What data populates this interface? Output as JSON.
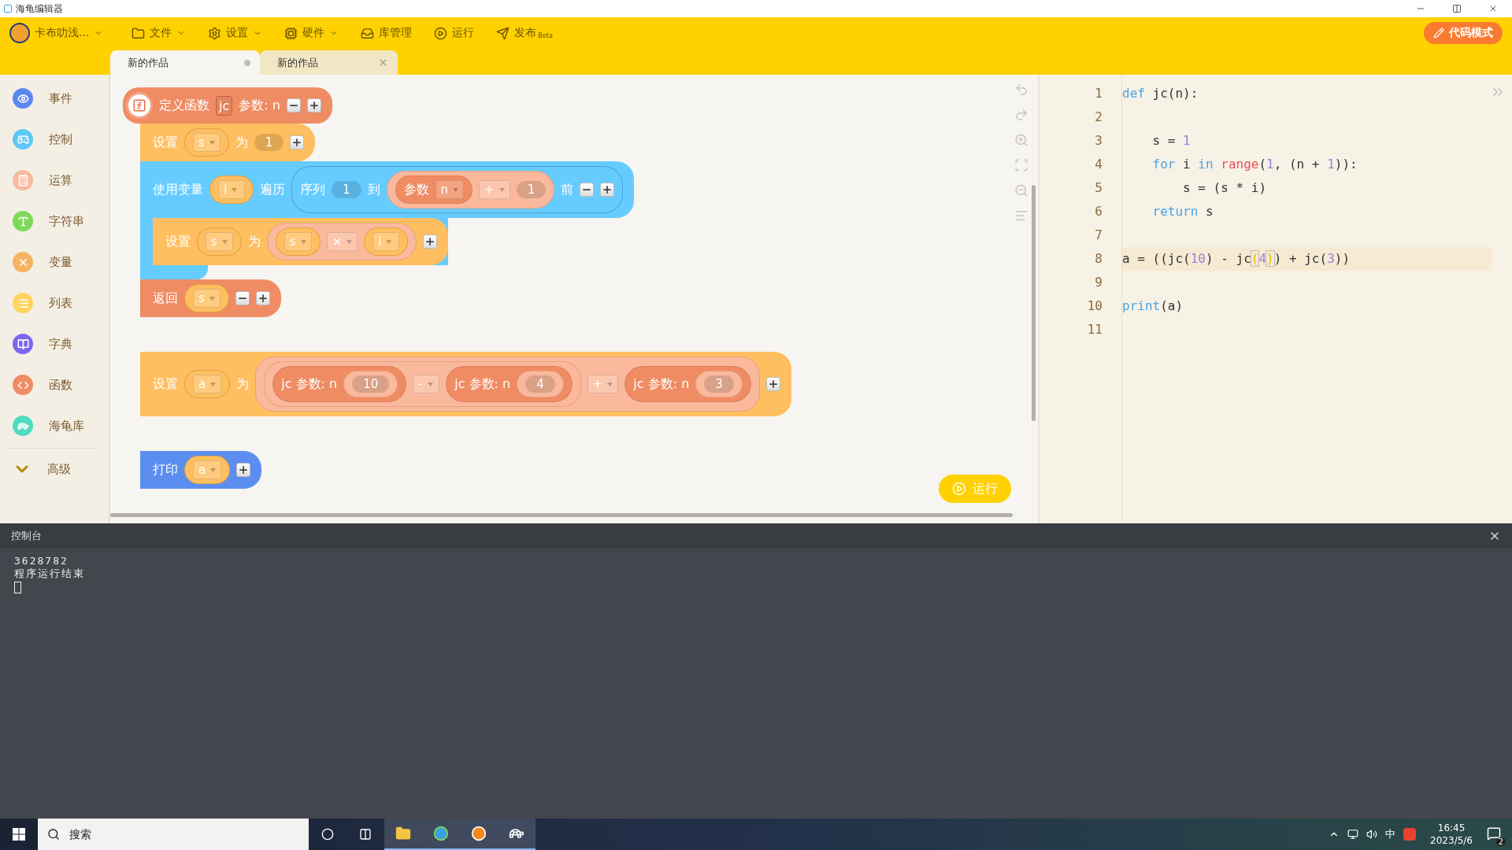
{
  "window": {
    "title": "海龟编辑器"
  },
  "toolbar": {
    "user": "卡布叻浅...",
    "menus": [
      {
        "label": "文件",
        "kind": "dropdown"
      },
      {
        "label": "设置",
        "kind": "dropdown"
      },
      {
        "label": "硬件",
        "kind": "dropdown"
      },
      {
        "label": "库管理",
        "kind": "action"
      },
      {
        "label": "运行",
        "kind": "action"
      },
      {
        "label": "发布",
        "kind": "action",
        "badge": "Beta"
      }
    ],
    "mode_button": "代码模式"
  },
  "tabs": [
    {
      "label": "新的作品",
      "selected": true,
      "kind": "unsaved"
    },
    {
      "label": "新的作品",
      "selected": false,
      "kind": "closable"
    }
  ],
  "sidebar": {
    "items": [
      {
        "label": "事件",
        "color": "#5b86f0"
      },
      {
        "label": "控制",
        "color": "#5ec8f8"
      },
      {
        "label": "运算",
        "color": "#f8b9a0"
      },
      {
        "label": "字符串",
        "color": "#7ed957"
      },
      {
        "label": "变量",
        "color": "#f5b363"
      },
      {
        "label": "列表",
        "color": "#ffd35c"
      },
      {
        "label": "字典",
        "color": "#7b68ee"
      },
      {
        "label": "函数",
        "color": "#ef8c63"
      },
      {
        "label": "海龟库",
        "color": "#4fdcc0"
      }
    ],
    "more": "高级"
  },
  "scripts": [
    {
      "blocks": [
        {
          "kind": "define",
          "parts": [
            {
              "kind": "label",
              "text": "定义函数"
            },
            {
              "kind": "name",
              "text": "jc"
            },
            {
              "kind": "label",
              "text": "参数: n"
            },
            {
              "kind": "remove"
            },
            {
              "kind": "add"
            }
          ],
          "children": [
            {
              "kind": "set",
              "parts": [
                {
                  "kind": "label",
                  "text": "设置"
                },
                {
                  "kind": "var",
                  "text": "s"
                },
                {
                  "kind": "label",
                  "text": "为"
                },
                {
                  "kind": "num",
                  "text": "1"
                },
                {
                  "kind": "add"
                }
              ]
            },
            {
              "kind": "loop",
              "parts": [
                {
                  "kind": "label",
                  "text": "使用变量"
                },
                {
                  "kind": "var",
                  "text": "i"
                },
                {
                  "kind": "label",
                  "text": "遍历"
                },
                {
                  "kind": "range",
                  "parts": [
                    {
                      "kind": "label",
                      "text": "序列"
                    },
                    {
                      "kind": "num",
                      "text": "1"
                    },
                    {
                      "kind": "label",
                      "text": "到"
                    },
                    {
                      "kind": "math",
                      "parts": [
                        {
                          "kind": "call",
                          "parts": [
                            {
                              "kind": "label",
                              "text": "参数"
                            },
                            {
                              "kind": "op",
                              "text": "n"
                            }
                          ]
                        },
                        {
                          "kind": "op",
                          "text": "+"
                        },
                        {
                          "kind": "num",
                          "text": "1"
                        }
                      ]
                    },
                    {
                      "kind": "label",
                      "text": "前"
                    },
                    {
                      "kind": "remove"
                    },
                    {
                      "kind": "add"
                    }
                  ]
                }
              ],
              "children": [
                {
                  "kind": "set",
                  "parts": [
                    {
                      "kind": "label",
                      "text": "设置"
                    },
                    {
                      "kind": "var",
                      "text": "s"
                    },
                    {
                      "kind": "label",
                      "text": "为"
                    },
                    {
                      "kind": "math",
                      "parts": [
                        {
                          "kind": "var",
                          "text": "s"
                        },
                        {
                          "kind": "op",
                          "text": "×"
                        },
                        {
                          "kind": "var",
                          "text": "i"
                        }
                      ]
                    },
                    {
                      "kind": "add"
                    }
                  ]
                }
              ]
            },
            {
              "kind": "return",
              "parts": [
                {
                  "kind": "label",
                  "text": "返回"
                },
                {
                  "kind": "var",
                  "text": "s"
                },
                {
                  "kind": "remove"
                },
                {
                  "kind": "add"
                }
              ]
            }
          ]
        }
      ]
    },
    {
      "blocks": [
        {
          "kind": "set",
          "parts": [
            {
              "kind": "label",
              "text": "设置"
            },
            {
              "kind": "var",
              "text": "a"
            },
            {
              "kind": "label",
              "text": "为"
            },
            {
              "kind": "math",
              "parts": [
                {
                  "kind": "math",
                  "parts": [
                    {
                      "kind": "call",
                      "parts": [
                        {
                          "kind": "label",
                          "text": "jc 参数: n"
                        },
                        {
                          "kind": "math",
                          "parts": [
                            {
                              "kind": "num",
                              "text": "10"
                            }
                          ]
                        }
                      ]
                    },
                    {
                      "kind": "op",
                      "text": "-"
                    },
                    {
                      "kind": "call",
                      "parts": [
                        {
                          "kind": "label",
                          "text": "jc 参数: n"
                        },
                        {
                          "kind": "math",
                          "parts": [
                            {
                              "kind": "num",
                              "text": "4"
                            }
                          ]
                        }
                      ]
                    }
                  ]
                },
                {
                  "kind": "op",
                  "text": "+"
                },
                {
                  "kind": "call",
                  "parts": [
                    {
                      "kind": "label",
                      "text": "jc 参数: n"
                    },
                    {
                      "kind": "math",
                      "parts": [
                        {
                          "kind": "num",
                          "text": "3"
                        }
                      ]
                    }
                  ]
                }
              ]
            },
            {
              "kind": "add"
            }
          ]
        }
      ]
    },
    {
      "blocks": [
        {
          "kind": "print",
          "parts": [
            {
              "kind": "label",
              "text": "打印"
            },
            {
              "kind": "var",
              "text": "a"
            },
            {
              "kind": "add"
            }
          ]
        }
      ]
    }
  ],
  "run_button": "运行",
  "code": {
    "lines": [
      {
        "number": "1",
        "highlighted": false,
        "tokens": [
          {
            "kind": "keyword",
            "text": "def"
          },
          {
            "kind": "plain",
            "text": " jc(n):"
          }
        ]
      },
      {
        "number": "2",
        "highlighted": false
      },
      {
        "number": "3",
        "highlighted": false,
        "tokens": [
          {
            "kind": "plain",
            "text": "    s = "
          },
          {
            "kind": "number",
            "text": "1"
          }
        ]
      },
      {
        "number": "4",
        "highlighted": false,
        "tokens": [
          {
            "kind": "keyword",
            "text": "    for"
          },
          {
            "kind": "plain",
            "text": " i "
          },
          {
            "kind": "keyword",
            "text": "in "
          },
          {
            "kind": "builtin",
            "text": "range"
          },
          {
            "kind": "plain",
            "text": "("
          },
          {
            "kind": "number",
            "text": "1"
          },
          {
            "kind": "plain",
            "text": ", (n + "
          },
          {
            "kind": "number",
            "text": "1"
          },
          {
            "kind": "plain",
            "text": ")):"
          }
        ]
      },
      {
        "number": "5",
        "highlighted": false,
        "tokens": [
          {
            "kind": "plain",
            "text": "        s = (s * i)"
          }
        ]
      },
      {
        "number": "6",
        "highlighted": false,
        "tokens": [
          {
            "kind": "keyword",
            "text": "    return"
          },
          {
            "kind": "plain",
            "text": " s"
          }
        ]
      },
      {
        "number": "7",
        "highlighted": false
      },
      {
        "number": "8",
        "highlighted": true,
        "tokens": [
          {
            "kind": "plain",
            "text": "a = ((jc("
          },
          {
            "kind": "number",
            "text": "10"
          },
          {
            "kind": "plain",
            "text": ") - jc"
          },
          {
            "kind": "match",
            "text": "("
          },
          {
            "kind": "number",
            "text": "4"
          },
          {
            "kind": "match",
            "text": ")"
          },
          {
            "kind": "plain",
            "text": ") + jc("
          },
          {
            "kind": "number",
            "text": "3"
          },
          {
            "kind": "plain",
            "text": "))"
          }
        ]
      },
      {
        "number": "9",
        "highlighted": false
      },
      {
        "number": "10",
        "highlighted": false,
        "tokens": [
          {
            "kind": "keyword",
            "text": "print"
          },
          {
            "kind": "plain",
            "text": "(a)"
          }
        ]
      },
      {
        "number": "11",
        "highlighted": false
      }
    ]
  },
  "console": {
    "title": "控制台",
    "lines": [
      "3628782",
      "程序运行结束"
    ]
  },
  "taskbar": {
    "search_placeholder": "搜索",
    "ime": "中",
    "time": "16:45",
    "date": "2023/5/6",
    "notifications": "2"
  }
}
